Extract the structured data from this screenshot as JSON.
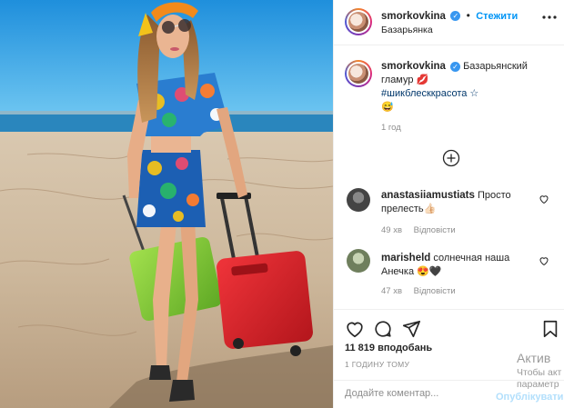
{
  "post": {
    "username": "smorkovkina",
    "follow_label": "Стежити",
    "location": "Базарьянка",
    "caption_text": "Базарьянский гламур 💋",
    "hashtag": "#шикблесккрасота ☆",
    "caption_emoji": "😅",
    "caption_time": "1 год",
    "likes": "11 819 вподобань",
    "posted_ago": "1 ГОДИНУ ТОМУ"
  },
  "comments": [
    {
      "username": "anastasiiamustiats",
      "text": "Просто прелесть👍🏻",
      "time": "49 хв",
      "reply": "Відповісти"
    },
    {
      "username": "marisheld",
      "text": "солнечная наша Анечка 😍🖤",
      "time": "47 хв",
      "reply": "Відповісти"
    }
  ],
  "composer": {
    "placeholder": "Додайте коментар...",
    "publish_label": "Опублікувати"
  },
  "watermark": {
    "line1": "Актив",
    "line2": "Чтобы акт",
    "line3": "параметр"
  },
  "icons": {
    "verified": "verified-badge-icon",
    "more": "more-options-icon",
    "add": "load-more-comments-icon",
    "like": "heart-icon",
    "comment": "comment-bubble-icon",
    "share": "paper-plane-icon",
    "save": "bookmark-icon"
  },
  "colors": {
    "link_blue": "#0095f6",
    "publish_disabled": "#b2dffc",
    "meta_gray": "#8e8e8e",
    "suitcase_red": "#d9242b",
    "suitcase_green": "#7cc43a",
    "sky": "#2f9fe0"
  }
}
